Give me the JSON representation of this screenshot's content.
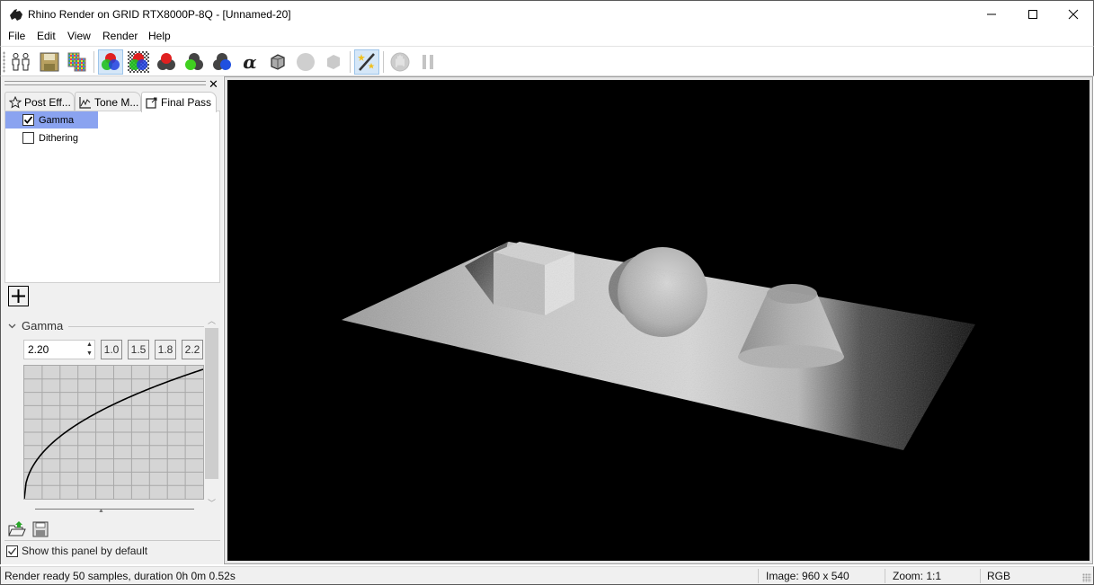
{
  "window": {
    "title": "Rhino Render on GRID RTX8000P-8Q - [Unnamed-20]",
    "controls": [
      "minimize",
      "maximize",
      "close"
    ]
  },
  "menu": {
    "items": [
      {
        "label": "File"
      },
      {
        "label": "Edit"
      },
      {
        "label": "View"
      },
      {
        "label": "Render"
      },
      {
        "label": "Help"
      }
    ]
  },
  "toolbar": {
    "buttons": [
      {
        "name": "clone-render-window",
        "icon": "people-icon"
      },
      {
        "name": "save-image",
        "icon": "floppy-disk-icon"
      },
      {
        "name": "copy-to-clipboard",
        "icon": "copy-image-icon"
      },
      {
        "name": "rgb-channel",
        "icon": "rgb-circles-icon",
        "active": true
      },
      {
        "name": "rgb-alpha-channel",
        "icon": "rgb-alpha-circles-icon"
      },
      {
        "name": "red-channel",
        "icon": "red-channel-icon"
      },
      {
        "name": "green-channel",
        "icon": "green-channel-icon"
      },
      {
        "name": "blue-channel",
        "icon": "blue-channel-icon"
      },
      {
        "name": "alpha-channel",
        "icon": "alpha-icon"
      },
      {
        "name": "luminance-channel",
        "icon": "gray-cube-icon"
      },
      {
        "name": "disabled-sphere",
        "icon": "sphere-icon",
        "disabled": true
      },
      {
        "name": "disabled-cube",
        "icon": "cube-icon",
        "disabled": true
      },
      {
        "name": "post-effects",
        "icon": "magic-wand-icon",
        "active": true
      },
      {
        "name": "stop-render",
        "icon": "stop-hand-icon",
        "disabled": true
      },
      {
        "name": "pause-render",
        "icon": "pause-icon",
        "disabled": true
      }
    ]
  },
  "panel": {
    "tabs": [
      {
        "label": "Post Eff...",
        "icon": "star-icon"
      },
      {
        "label": "Tone M...",
        "icon": "chart-icon"
      },
      {
        "label": "Final Pass",
        "icon": "export-icon",
        "active": true
      }
    ],
    "effects": [
      {
        "label": "Gamma",
        "checked": true,
        "selected": true
      },
      {
        "label": "Dithering",
        "checked": false,
        "selected": false
      }
    ],
    "add_button": "+",
    "section": {
      "title": "Gamma",
      "expanded": true,
      "value": "2.20",
      "presets": [
        "1.0",
        "1.5",
        "1.8",
        "2.2"
      ],
      "curve_gamma": 2.2
    },
    "show_by_default": {
      "label": "Show this panel by default",
      "checked": true
    }
  },
  "status": {
    "message": "Render ready 50 samples, duration 0h 0m 0.52s",
    "image_size": "Image: 960 x 540",
    "zoom": "Zoom: 1:1",
    "channel": "RGB"
  }
}
